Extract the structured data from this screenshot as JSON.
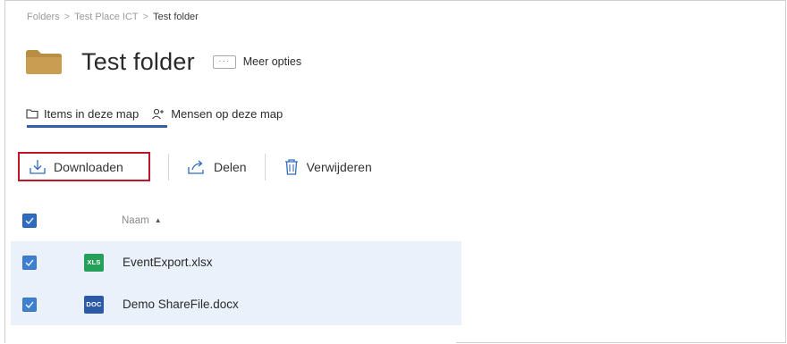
{
  "breadcrumb": {
    "items": [
      "Folders",
      "Test Place ICT"
    ],
    "separator": ">",
    "current": "Test folder"
  },
  "folder": {
    "icon": "folder-icon",
    "title": "Test folder",
    "more_icon": "ellipsis-icon",
    "more_glyph": "···",
    "more_label": "Meer opties"
  },
  "tabs": [
    {
      "label": "Items in deze map",
      "icon": "folder-outline-icon",
      "active": true
    },
    {
      "label": "Mensen op deze map",
      "icon": "people-icon",
      "active": false
    }
  ],
  "toolbar": {
    "download_label": "Downloaden",
    "share_label": "Delen",
    "delete_label": "Verwijderen"
  },
  "table": {
    "column_name": "Naam",
    "sort_indicator": "▲",
    "rows": [
      {
        "badge": "XLS",
        "name": "EventExport.xlsx",
        "checked": true
      },
      {
        "badge": "DOC",
        "name": "Demo ShareFile.docx",
        "checked": true
      }
    ]
  },
  "colors": {
    "accent": "#2f5eaa",
    "highlight_border": "#c0162c",
    "row_selected": "#eaf1fa",
    "xls": "#25a05a",
    "doc": "#2d5aa6",
    "folder": "#b98d43"
  }
}
